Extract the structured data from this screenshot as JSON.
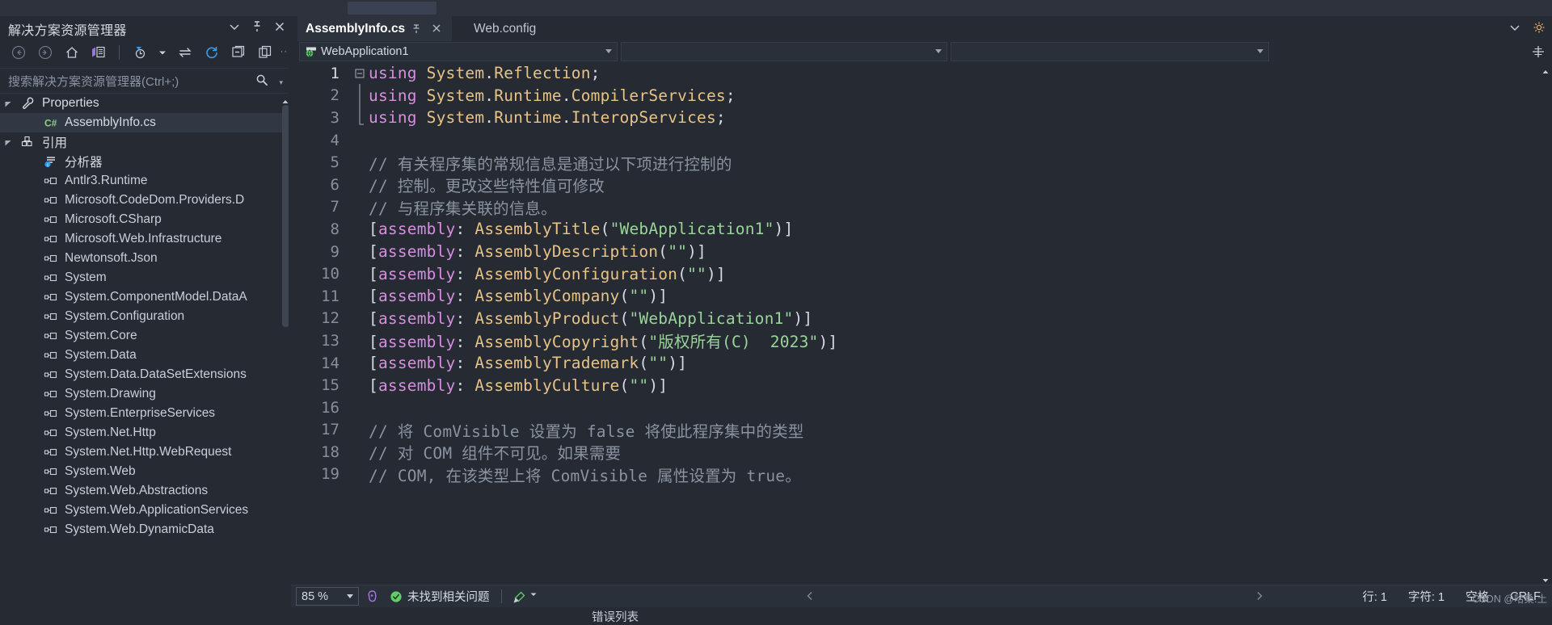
{
  "window": {
    "background": "#252A33",
    "accent": "#D68FDD"
  },
  "solution_explorer": {
    "title": "解决方案资源管理器",
    "header_icons": [
      {
        "name": "chevron-down-icon",
        "glyph": "▾"
      },
      {
        "name": "pin-icon",
        "glyph": "pin"
      },
      {
        "name": "close-icon",
        "glyph": "✕"
      }
    ],
    "toolbar": [
      {
        "name": "back-icon",
        "title": "后退"
      },
      {
        "name": "forward-icon",
        "title": "前进"
      },
      {
        "name": "home-icon",
        "title": "主页"
      },
      {
        "name": "solution-view-icon",
        "title": "解决方案视图"
      },
      {
        "name": "pending-changes-filter-icon",
        "title": "挂起的更改筛选器"
      },
      {
        "name": "filter-dropdown-icon",
        "title": "筛选器下拉"
      },
      {
        "name": "sync-with-active-document-icon",
        "title": "与活动文档同步"
      },
      {
        "name": "refresh-icon",
        "title": "刷新"
      },
      {
        "name": "collapse-all-icon",
        "title": "全部折叠"
      },
      {
        "name": "show-all-files-icon",
        "title": "显示所有文件"
      },
      {
        "name": "code-view-icon",
        "title": "查看代码"
      }
    ],
    "search_placeholder": "搜索解决方案资源管理器(Ctrl+;)",
    "search_icon": "search-icon",
    "tree": [
      {
        "label": "Properties",
        "icon": "wrench-icon",
        "indent": 1,
        "expanded": true,
        "selected": false,
        "kind": "folder"
      },
      {
        "label": "AssemblyInfo.cs",
        "icon": "csharp-file-icon",
        "indent": 2,
        "expanded": null,
        "selected": true,
        "kind": "file"
      },
      {
        "label": "引用",
        "icon": "references-icon",
        "indent": 1,
        "expanded": true,
        "selected": false,
        "kind": "folder"
      },
      {
        "label": "分析器",
        "icon": "analyzers-icon",
        "indent": 2,
        "expanded": null,
        "selected": false,
        "kind": "analyzers"
      },
      {
        "label": "Antlr3.Runtime",
        "icon": "reference-icon",
        "indent": 2,
        "expanded": null,
        "selected": false,
        "kind": "ref"
      },
      {
        "label": "Microsoft.CodeDom.Providers.D",
        "icon": "reference-icon",
        "indent": 2,
        "expanded": null,
        "selected": false,
        "kind": "ref"
      },
      {
        "label": "Microsoft.CSharp",
        "icon": "reference-icon",
        "indent": 2,
        "expanded": null,
        "selected": false,
        "kind": "ref"
      },
      {
        "label": "Microsoft.Web.Infrastructure",
        "icon": "reference-icon",
        "indent": 2,
        "expanded": null,
        "selected": false,
        "kind": "ref"
      },
      {
        "label": "Newtonsoft.Json",
        "icon": "reference-icon",
        "indent": 2,
        "expanded": null,
        "selected": false,
        "kind": "ref"
      },
      {
        "label": "System",
        "icon": "reference-icon",
        "indent": 2,
        "expanded": null,
        "selected": false,
        "kind": "ref"
      },
      {
        "label": "System.ComponentModel.DataA",
        "icon": "reference-icon",
        "indent": 2,
        "expanded": null,
        "selected": false,
        "kind": "ref"
      },
      {
        "label": "System.Configuration",
        "icon": "reference-icon",
        "indent": 2,
        "expanded": null,
        "selected": false,
        "kind": "ref"
      },
      {
        "label": "System.Core",
        "icon": "reference-icon",
        "indent": 2,
        "expanded": null,
        "selected": false,
        "kind": "ref"
      },
      {
        "label": "System.Data",
        "icon": "reference-icon",
        "indent": 2,
        "expanded": null,
        "selected": false,
        "kind": "ref"
      },
      {
        "label": "System.Data.DataSetExtensions",
        "icon": "reference-icon",
        "indent": 2,
        "expanded": null,
        "selected": false,
        "kind": "ref"
      },
      {
        "label": "System.Drawing",
        "icon": "reference-icon",
        "indent": 2,
        "expanded": null,
        "selected": false,
        "kind": "ref"
      },
      {
        "label": "System.EnterpriseServices",
        "icon": "reference-icon",
        "indent": 2,
        "expanded": null,
        "selected": false,
        "kind": "ref"
      },
      {
        "label": "System.Net.Http",
        "icon": "reference-icon",
        "indent": 2,
        "expanded": null,
        "selected": false,
        "kind": "ref"
      },
      {
        "label": "System.Net.Http.WebRequest",
        "icon": "reference-icon",
        "indent": 2,
        "expanded": null,
        "selected": false,
        "kind": "ref"
      },
      {
        "label": "System.Web",
        "icon": "reference-icon",
        "indent": 2,
        "expanded": null,
        "selected": false,
        "kind": "ref"
      },
      {
        "label": "System.Web.Abstractions",
        "icon": "reference-icon",
        "indent": 2,
        "expanded": null,
        "selected": false,
        "kind": "ref"
      },
      {
        "label": "System.Web.ApplicationServices",
        "icon": "reference-icon",
        "indent": 2,
        "expanded": null,
        "selected": false,
        "kind": "ref"
      },
      {
        "label": "System.Web.DynamicData",
        "icon": "reference-icon",
        "indent": 2,
        "expanded": null,
        "selected": false,
        "kind": "ref"
      }
    ]
  },
  "editor": {
    "tabs": [
      {
        "label": "AssemblyInfo.cs",
        "active": true,
        "pinned": true,
        "closable": true
      },
      {
        "label": "Web.config",
        "active": false,
        "pinned": false,
        "closable": false
      }
    ],
    "tab_bar_icons": [
      {
        "name": "chevron-down-icon",
        "glyph": "▾"
      },
      {
        "name": "gear-icon",
        "glyph": "gear"
      }
    ],
    "navigation_bar": {
      "project": "WebApplication1",
      "project_icon": "web-project-icon",
      "type_dropdown": "",
      "member_dropdown": "",
      "split_icon": "split-window-icon"
    },
    "code_lines": [
      {
        "n": "1",
        "fold": "minus",
        "tokens": [
          {
            "t": "using",
            "c": "k"
          },
          {
            "t": " ",
            "c": "p"
          },
          {
            "t": "System",
            "c": "t"
          },
          {
            "t": ".",
            "c": "p"
          },
          {
            "t": "Reflection",
            "c": "t"
          },
          {
            "t": ";",
            "c": "p"
          }
        ]
      },
      {
        "n": "2",
        "fold": "bar",
        "tokens": [
          {
            "t": "using",
            "c": "k"
          },
          {
            "t": " ",
            "c": "p"
          },
          {
            "t": "System",
            "c": "t"
          },
          {
            "t": ".",
            "c": "p"
          },
          {
            "t": "Runtime",
            "c": "t"
          },
          {
            "t": ".",
            "c": "p"
          },
          {
            "t": "CompilerServices",
            "c": "t"
          },
          {
            "t": ";",
            "c": "p"
          }
        ]
      },
      {
        "n": "3",
        "fold": "barend",
        "tokens": [
          {
            "t": "using",
            "c": "k"
          },
          {
            "t": " ",
            "c": "p"
          },
          {
            "t": "System",
            "c": "t"
          },
          {
            "t": ".",
            "c": "p"
          },
          {
            "t": "Runtime",
            "c": "t"
          },
          {
            "t": ".",
            "c": "p"
          },
          {
            "t": "InteropServices",
            "c": "t"
          },
          {
            "t": ";",
            "c": "p"
          }
        ]
      },
      {
        "n": "4",
        "fold": "",
        "tokens": []
      },
      {
        "n": "5",
        "fold": "",
        "tokens": [
          {
            "t": "// 有关程序集的常规信息是通过以下项进行控制的",
            "c": "c"
          }
        ]
      },
      {
        "n": "6",
        "fold": "",
        "tokens": [
          {
            "t": "// 控制。更改这些特性值可修改",
            "c": "c"
          }
        ]
      },
      {
        "n": "7",
        "fold": "",
        "tokens": [
          {
            "t": "// 与程序集关联的信息。",
            "c": "c"
          }
        ]
      },
      {
        "n": "8",
        "fold": "",
        "tokens": [
          {
            "t": "[",
            "c": "p"
          },
          {
            "t": "assembly",
            "c": "k"
          },
          {
            "t": ": ",
            "c": "p"
          },
          {
            "t": "AssemblyTitle",
            "c": "t"
          },
          {
            "t": "(",
            "c": "p"
          },
          {
            "t": "\"WebApplication1\"",
            "c": "s"
          },
          {
            "t": ")]",
            "c": "p"
          }
        ]
      },
      {
        "n": "9",
        "fold": "",
        "tokens": [
          {
            "t": "[",
            "c": "p"
          },
          {
            "t": "assembly",
            "c": "k"
          },
          {
            "t": ": ",
            "c": "p"
          },
          {
            "t": "AssemblyDescription",
            "c": "t"
          },
          {
            "t": "(",
            "c": "p"
          },
          {
            "t": "\"\"",
            "c": "s"
          },
          {
            "t": ")]",
            "c": "p"
          }
        ]
      },
      {
        "n": "10",
        "fold": "",
        "tokens": [
          {
            "t": "[",
            "c": "p"
          },
          {
            "t": "assembly",
            "c": "k"
          },
          {
            "t": ": ",
            "c": "p"
          },
          {
            "t": "AssemblyConfiguration",
            "c": "t"
          },
          {
            "t": "(",
            "c": "p"
          },
          {
            "t": "\"\"",
            "c": "s"
          },
          {
            "t": ")]",
            "c": "p"
          }
        ]
      },
      {
        "n": "11",
        "fold": "",
        "tokens": [
          {
            "t": "[",
            "c": "p"
          },
          {
            "t": "assembly",
            "c": "k"
          },
          {
            "t": ": ",
            "c": "p"
          },
          {
            "t": "AssemblyCompany",
            "c": "t"
          },
          {
            "t": "(",
            "c": "p"
          },
          {
            "t": "\"\"",
            "c": "s"
          },
          {
            "t": ")]",
            "c": "p"
          }
        ]
      },
      {
        "n": "12",
        "fold": "",
        "tokens": [
          {
            "t": "[",
            "c": "p"
          },
          {
            "t": "assembly",
            "c": "k"
          },
          {
            "t": ": ",
            "c": "p"
          },
          {
            "t": "AssemblyProduct",
            "c": "t"
          },
          {
            "t": "(",
            "c": "p"
          },
          {
            "t": "\"WebApplication1\"",
            "c": "s"
          },
          {
            "t": ")]",
            "c": "p"
          }
        ]
      },
      {
        "n": "13",
        "fold": "",
        "tokens": [
          {
            "t": "[",
            "c": "p"
          },
          {
            "t": "assembly",
            "c": "k"
          },
          {
            "t": ": ",
            "c": "p"
          },
          {
            "t": "AssemblyCopyright",
            "c": "t"
          },
          {
            "t": "(",
            "c": "p"
          },
          {
            "t": "\"版权所有(C)  2023\"",
            "c": "s"
          },
          {
            "t": ")]",
            "c": "p"
          }
        ]
      },
      {
        "n": "14",
        "fold": "",
        "tokens": [
          {
            "t": "[",
            "c": "p"
          },
          {
            "t": "assembly",
            "c": "k"
          },
          {
            "t": ": ",
            "c": "p"
          },
          {
            "t": "AssemblyTrademark",
            "c": "t"
          },
          {
            "t": "(",
            "c": "p"
          },
          {
            "t": "\"\"",
            "c": "s"
          },
          {
            "t": ")]",
            "c": "p"
          }
        ]
      },
      {
        "n": "15",
        "fold": "",
        "tokens": [
          {
            "t": "[",
            "c": "p"
          },
          {
            "t": "assembly",
            "c": "k"
          },
          {
            "t": ": ",
            "c": "p"
          },
          {
            "t": "AssemblyCulture",
            "c": "t"
          },
          {
            "t": "(",
            "c": "p"
          },
          {
            "t": "\"\"",
            "c": "s"
          },
          {
            "t": ")]",
            "c": "p"
          }
        ]
      },
      {
        "n": "16",
        "fold": "",
        "tokens": []
      },
      {
        "n": "17",
        "fold": "",
        "tokens": [
          {
            "t": "// 将 ComVisible 设置为 false 将使此程序集中的类型",
            "c": "c"
          }
        ]
      },
      {
        "n": "18",
        "fold": "",
        "tokens": [
          {
            "t": "// 对 COM 组件不可见。如果需要",
            "c": "c"
          }
        ]
      },
      {
        "n": "19",
        "fold": "",
        "tokens": [
          {
            "t": "// COM, 在该类型上将 ComVisible 属性设置为 true。",
            "c": "c"
          }
        ]
      }
    ]
  },
  "status_bar": {
    "zoom": "85 %",
    "zoom_caret_icon": "chevron-down-icon",
    "intellicode_icon": "intellicode-icon",
    "issue_icon": "check-circle-icon",
    "issue_text": "未找到相关问题",
    "brush_icon": "brush-icon",
    "brush_caret_icon": "chevron-down-icon",
    "nav_back_icon": "chevron-left-icon",
    "nav_fwd_icon": "chevron-right-icon",
    "line": "行: 1",
    "column": "字符: 1",
    "spaces": "空格",
    "eol": "CRLF"
  },
  "bottom_dock": {
    "label": "错误列表"
  },
  "watermark": "CSDN @哈桑.土"
}
